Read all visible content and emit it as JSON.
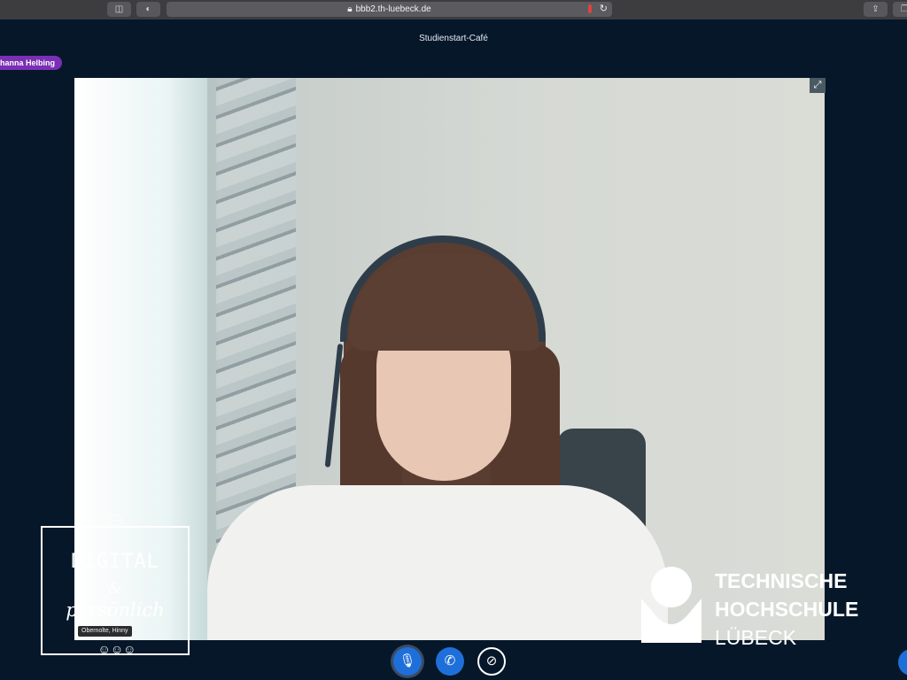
{
  "browser": {
    "url": "bbb2.th-luebeck.de",
    "lock_icon": "lock-icon",
    "reload_icon": "reload-icon",
    "share_icon": "share-icon"
  },
  "meeting": {
    "title": "Studienstart-Café"
  },
  "presenter": {
    "name": "hanna Helbing"
  },
  "video": {
    "fullscreen_icon": "fullscreen-icon"
  },
  "overlay_logo": {
    "line1": "DIGITAL",
    "line2": "&",
    "line3": "persönlich",
    "tooltip": "Obernolte, Hinny"
  },
  "institution": {
    "line1": "TECHNISCHE",
    "line2": "HOCHSCHULE",
    "line3": "LÜBECK"
  },
  "controls": {
    "mic": "microphone-icon",
    "phone": "phone-icon",
    "camera": "camera-off-icon"
  },
  "colors": {
    "background": "#06172a",
    "accent": "#1e6fd9",
    "badge": "#7a2fb5"
  }
}
